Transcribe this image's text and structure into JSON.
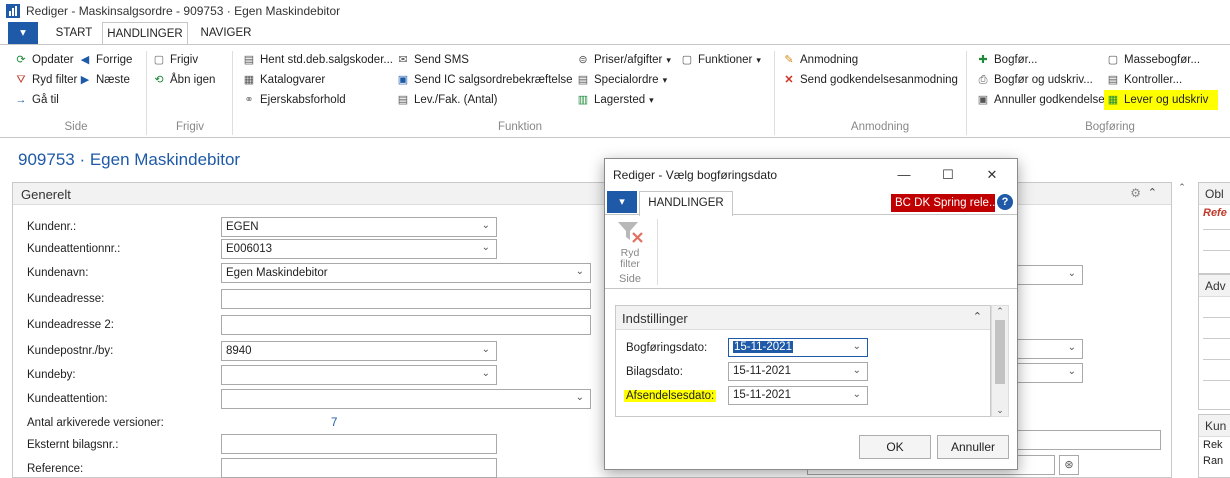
{
  "window": {
    "title": "Rediger - Maskinsalgsordre - 909753 · Egen Maskindebitor"
  },
  "ribbon_tabs": [
    "START",
    "HANDLINGER",
    "NAVIGER"
  ],
  "ribbon": {
    "side": {
      "items": [
        "Opdater",
        "Forrige",
        "Ryd filter",
        "Næste",
        "Gå til"
      ],
      "label": "Side"
    },
    "frigiv": {
      "items": [
        "Frigiv",
        "Åbn igen"
      ],
      "label": "Frigiv"
    },
    "funktion": {
      "items": [
        "Hent std.deb.salgskoder...",
        "Send SMS",
        "Katalogvarer",
        "Send IC salgsordrebekræftelse",
        "Ejerskabsforhold",
        "Lev./Fak. (Antal)",
        "Priser/afgifter",
        "Funktioner",
        "Specialordre",
        "Lagersted"
      ],
      "label": "Funktion"
    },
    "anmodning": {
      "items": [
        "Anmodning",
        "Send godkendelsesanmodning"
      ],
      "label": "Anmodning"
    },
    "bogforing": {
      "items": [
        "Bogfør...",
        "Massebogfør...",
        "Bogfør og udskriv...",
        "Kontroller...",
        "Annuller godkendelse...",
        "Lever og udskriv"
      ],
      "label": "Bogføring"
    }
  },
  "page_title": "909753 · Egen Maskindebitor",
  "general": {
    "header": "Generelt",
    "fields": [
      {
        "label": "Kundenr.:",
        "value": "EGEN"
      },
      {
        "label": "Kundeattentionnr.:",
        "value": "E006013"
      },
      {
        "label": "Kundenavn:",
        "value": "Egen Maskindebitor"
      },
      {
        "label": "Kundeadresse:",
        "value": ""
      },
      {
        "label": "Kundeadresse 2:",
        "value": ""
      },
      {
        "label": "Kundepostnr./by:",
        "value": "8940"
      },
      {
        "label": "Kundeby:",
        "value": ""
      },
      {
        "label": "Kundeattention:",
        "value": ""
      },
      {
        "label": "Antal arkiverede versioner:",
        "value": "7"
      },
      {
        "label": "Eksternt bilagsnr.:",
        "value": ""
      },
      {
        "label": "Reference:",
        "value": ""
      }
    ]
  },
  "right_panels": {
    "p1_head": "Obl",
    "p1_sub": "Refe",
    "p2_head": "Adv",
    "p3_head": "Kun",
    "p3_line1": "Rek",
    "p3_line2": "Ran"
  },
  "dialog": {
    "title": "Rediger - Vælg bogføringsdato",
    "tab": "HANDLINGER",
    "badge": "BC DK Spring rele...",
    "ribbon_action": "Ryd filter",
    "ribbon_group": "Side",
    "section": "Indstillinger",
    "fields": [
      {
        "label": "Bogføringsdato:",
        "value": "15-11-2021"
      },
      {
        "label": "Bilagsdato:",
        "value": "15-11-2021"
      },
      {
        "label": "Afsendelsesdato:",
        "value": "15-11-2021"
      }
    ],
    "ok": "OK",
    "cancel": "Annuller"
  },
  "colors": {
    "accent": "#1e5aa7",
    "highlight": "#ffff00",
    "badge": "#c00000"
  }
}
